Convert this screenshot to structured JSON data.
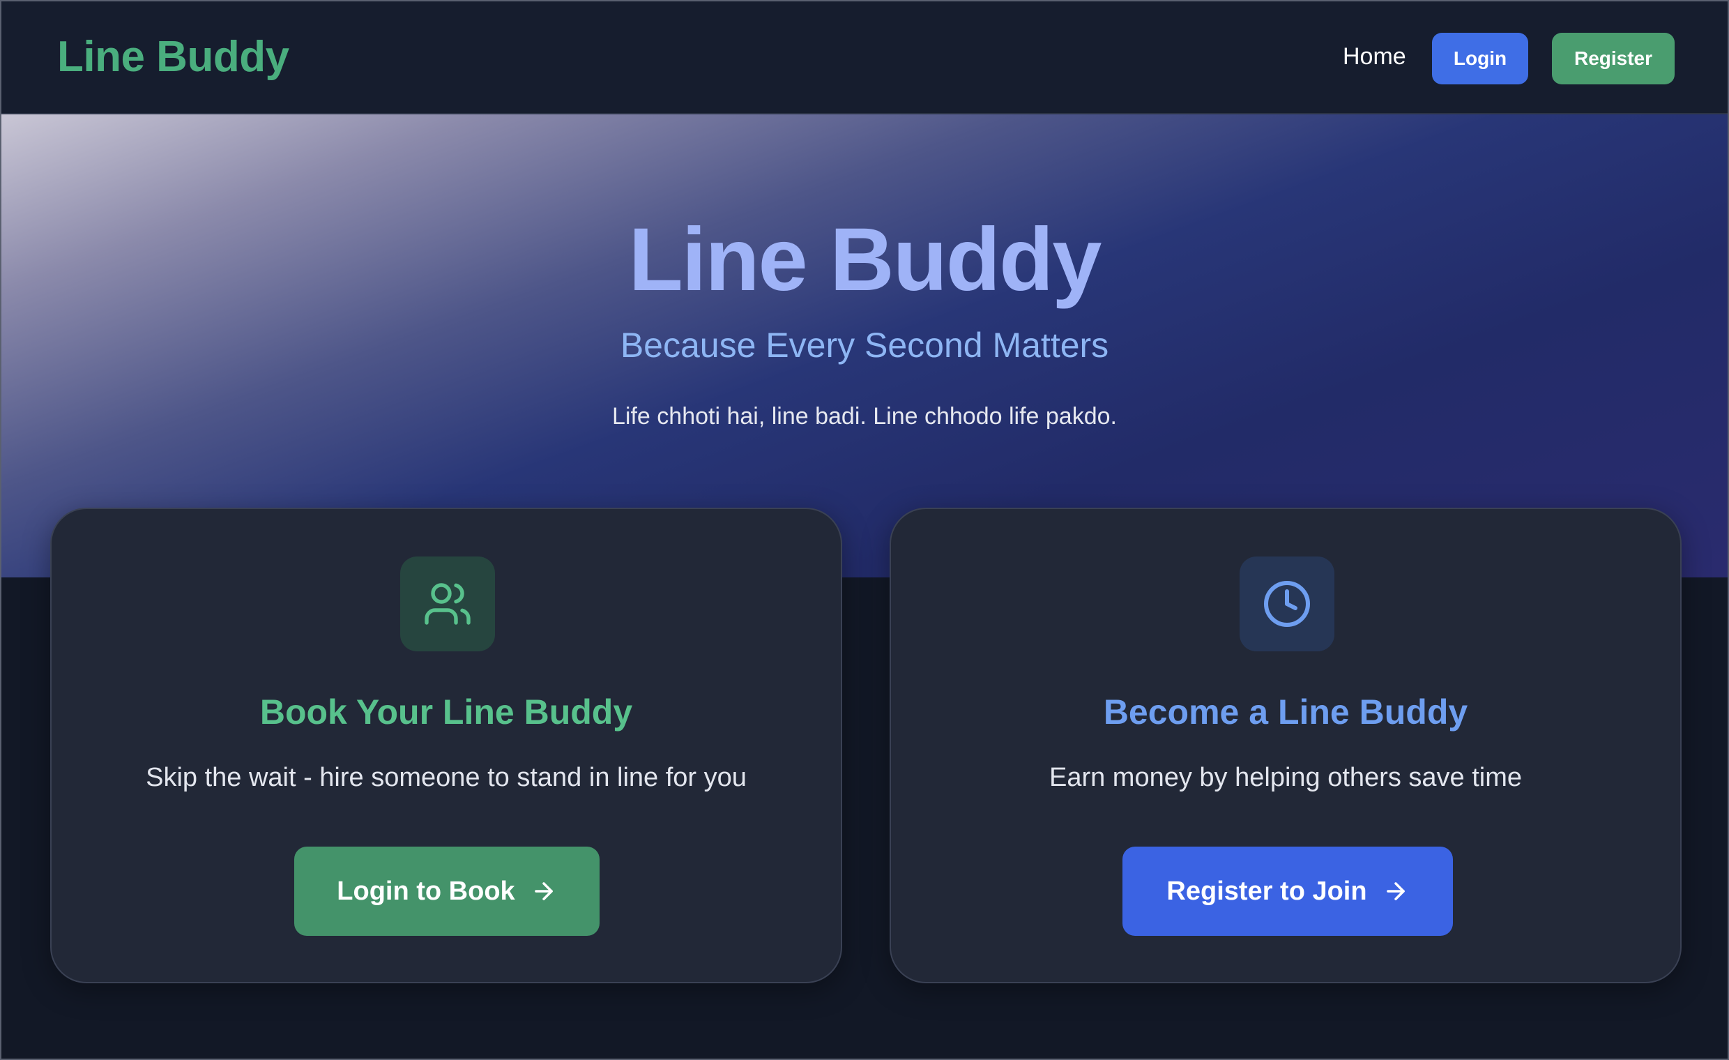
{
  "nav": {
    "brand": "Line Buddy",
    "home": "Home",
    "login": "Login",
    "register": "Register"
  },
  "hero": {
    "title": "Line Buddy",
    "subtitle": "Because Every Second Matters",
    "tagline": "Life chhoti hai, line badi. Line chhodo life pakdo."
  },
  "cards": [
    {
      "icon": "users-icon",
      "title": "Book Your Line Buddy",
      "description": "Skip the wait - hire someone to stand in line for you",
      "button": "Login to Book"
    },
    {
      "icon": "clock-icon",
      "title": "Become a Line Buddy",
      "description": "Earn money by helping others save time",
      "button": "Register to Join"
    }
  ],
  "colors": {
    "green_accent": "#4aae7e",
    "blue_accent": "#3f6ee6",
    "background": "#121826",
    "card_background": "#222837"
  }
}
